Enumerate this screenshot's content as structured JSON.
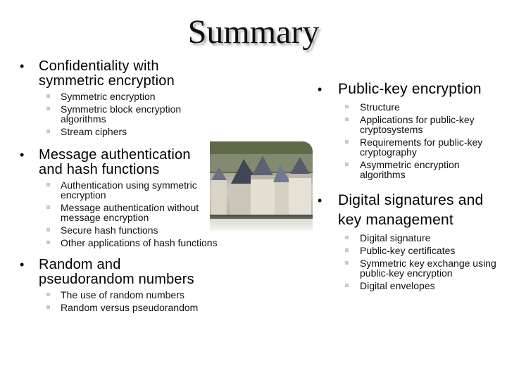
{
  "slide": {
    "title": "Summary",
    "image_alt": "castle-photo"
  },
  "left_column": [
    {
      "heading": "Confidentiality with symmetric encryption",
      "items": [
        "Symmetric encryption",
        "Symmetric block encryption algorithms",
        "Stream ciphers"
      ]
    },
    {
      "heading": "Message authentication and hash functions",
      "items": [
        "Authentication using  symmetric encryption",
        "Message authentication without message encryption",
        "Secure hash functions",
        "Other applications of hash functions"
      ]
    },
    {
      "heading": "Random and pseudorandom numbers",
      "items": [
        "The use of random numbers",
        "Random versus pseudorandom"
      ]
    }
  ],
  "right_column": [
    {
      "heading": "Public-key encryption",
      "items": [
        "Structure",
        "Applications for public-key cryptosystems",
        "Requirements for public-key cryptography",
        "Asymmetric encryption algorithms"
      ]
    },
    {
      "heading": "Digital signatures and key management",
      "items": [
        "Digital signature",
        "Public-key certificates",
        "Symmetric key exchange using public-key encryption",
        "Digital envelopes"
      ]
    }
  ],
  "bullets": {
    "main": "•",
    "sub_color": "#cfc8bd"
  }
}
